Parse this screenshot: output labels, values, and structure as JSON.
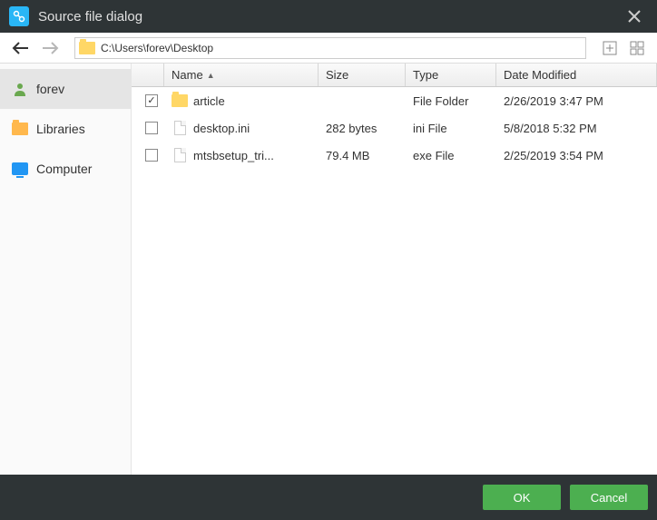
{
  "titlebar": {
    "title": "Source file dialog"
  },
  "toolbar": {
    "path": "C:\\Users\\forev\\Desktop"
  },
  "sidebar": {
    "items": [
      {
        "label": "forev"
      },
      {
        "label": "Libraries"
      },
      {
        "label": "Computer"
      }
    ]
  },
  "columns": {
    "name": "Name",
    "size": "Size",
    "type": "Type",
    "date": "Date Modified"
  },
  "files": [
    {
      "checked": true,
      "icon": "folder",
      "name": "article",
      "size": "",
      "type": "File Folder",
      "date": "2/26/2019 3:47 PM"
    },
    {
      "checked": false,
      "icon": "file",
      "name": "desktop.ini",
      "size": "282 bytes",
      "type": "ini File",
      "date": "5/8/2018 5:32 PM"
    },
    {
      "checked": false,
      "icon": "file",
      "name": "mtsbsetup_tri...",
      "size": "79.4 MB",
      "type": "exe File",
      "date": "2/25/2019 3:54 PM"
    }
  ],
  "footer": {
    "ok": "OK",
    "cancel": "Cancel"
  }
}
